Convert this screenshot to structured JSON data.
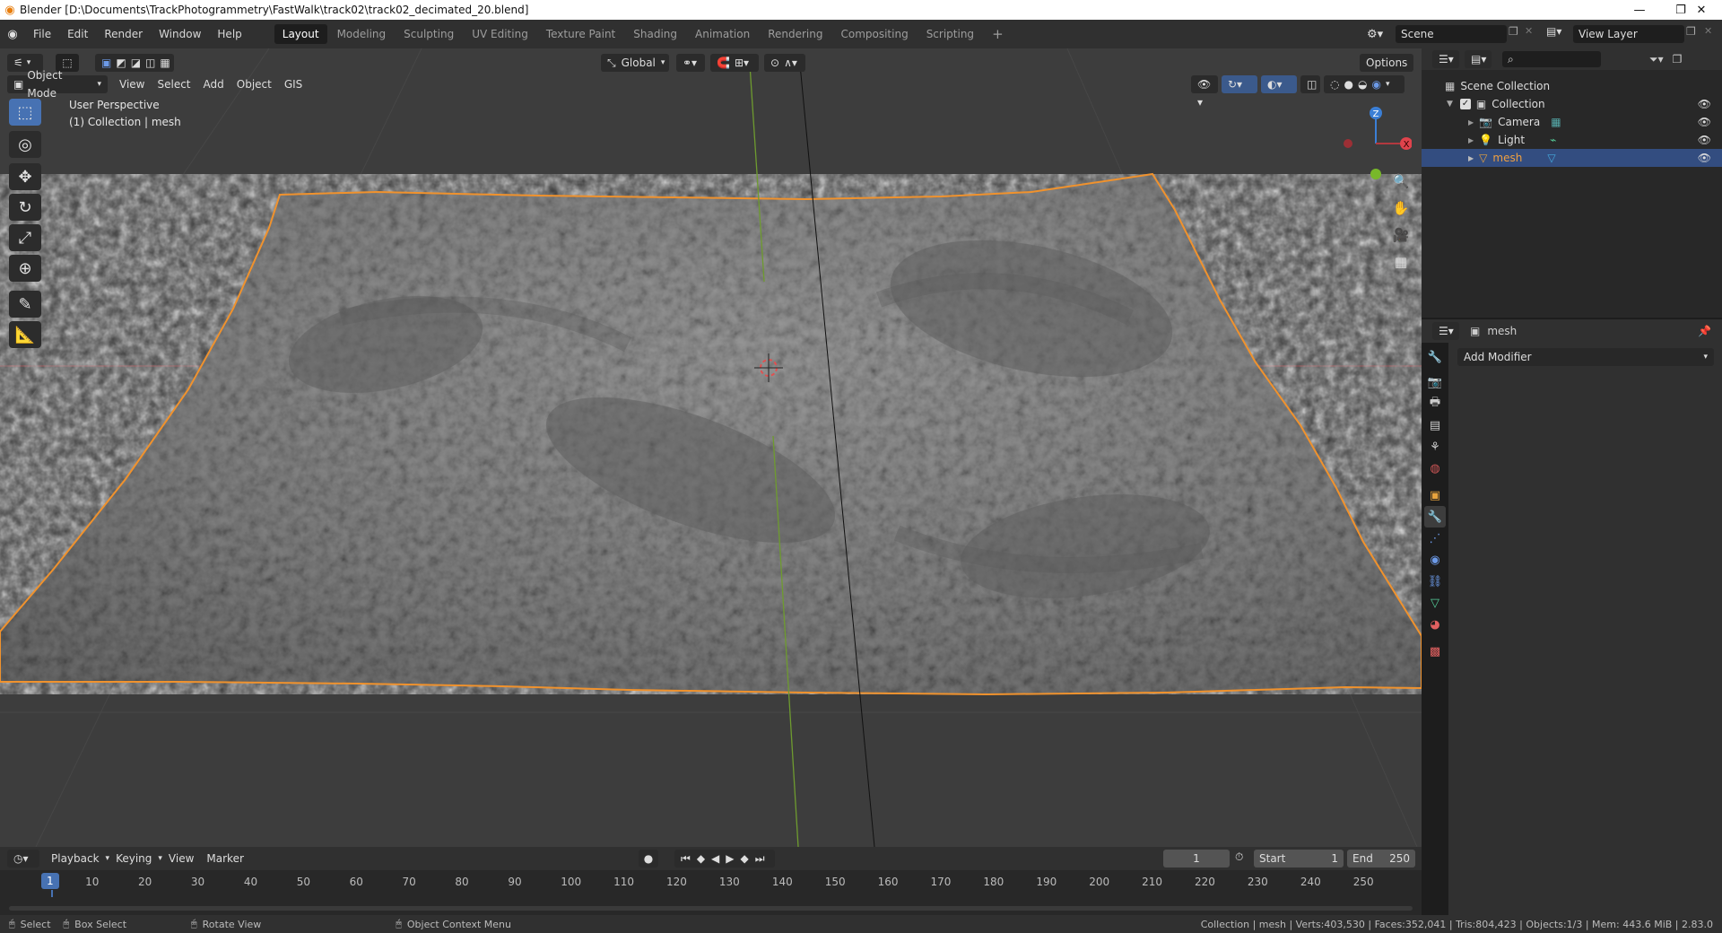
{
  "window": {
    "title": "Blender [D:\\Documents\\TrackPhotogrammetry\\FastWalk\\track02\\track02_decimated_20.blend]",
    "minimize_glyph": "—",
    "restore_glyph": "❐",
    "close_glyph": "✕"
  },
  "menu": [
    "File",
    "Edit",
    "Render",
    "Window",
    "Help"
  ],
  "workspace_tabs": [
    "Layout",
    "Modeling",
    "Sculpting",
    "UV Editing",
    "Texture Paint",
    "Shading",
    "Animation",
    "Rendering",
    "Compositing",
    "Scripting"
  ],
  "workspace_add": "+",
  "scene": {
    "name": "Scene",
    "view_layer": "View Layer"
  },
  "viewport": {
    "mode": "Object Mode",
    "menus": [
      "View",
      "Select",
      "Add",
      "Object",
      "GIS"
    ],
    "orientation": "Global",
    "options_label": "Options",
    "overlay_text_1": "User Perspective",
    "overlay_text_2": "(1) Collection | mesh",
    "gizmo": {
      "z": "Z",
      "x": "X"
    },
    "colors": {
      "background": "#3d3d3d",
      "selection_outline": "#f0922d",
      "x_axis": "#b3393f",
      "y_axis": "#6e9b2f",
      "active_tool": "#4772b3"
    }
  },
  "timeline": {
    "menus": [
      "Playback",
      "Keying",
      "View",
      "Marker"
    ],
    "current_frame": "1",
    "start_label": "Start",
    "start_value": "1",
    "end_label": "End",
    "end_value": "250",
    "ruler": [
      "1",
      "10",
      "20",
      "30",
      "40",
      "50",
      "60",
      "70",
      "80",
      "90",
      "100",
      "110",
      "120",
      "130",
      "140",
      "150",
      "160",
      "170",
      "180",
      "190",
      "200",
      "210",
      "220",
      "230",
      "240",
      "250"
    ]
  },
  "outliner": {
    "scene_collection": "Scene Collection",
    "collection": "Collection",
    "items": [
      "Camera",
      "Light",
      "mesh"
    ],
    "selected": "mesh"
  },
  "properties": {
    "object_name": "mesh",
    "add_modifier": "Add Modifier"
  },
  "status": {
    "select": "Select",
    "box_select": "Box Select",
    "rotate_view": "Rotate View",
    "context_menu": "Object Context Menu",
    "stats": "Collection | mesh | Verts:403,530 | Faces:352,041 | Tris:804,423 | Objects:1/3 | Mem: 443.6 MiB | 2.83.0"
  }
}
